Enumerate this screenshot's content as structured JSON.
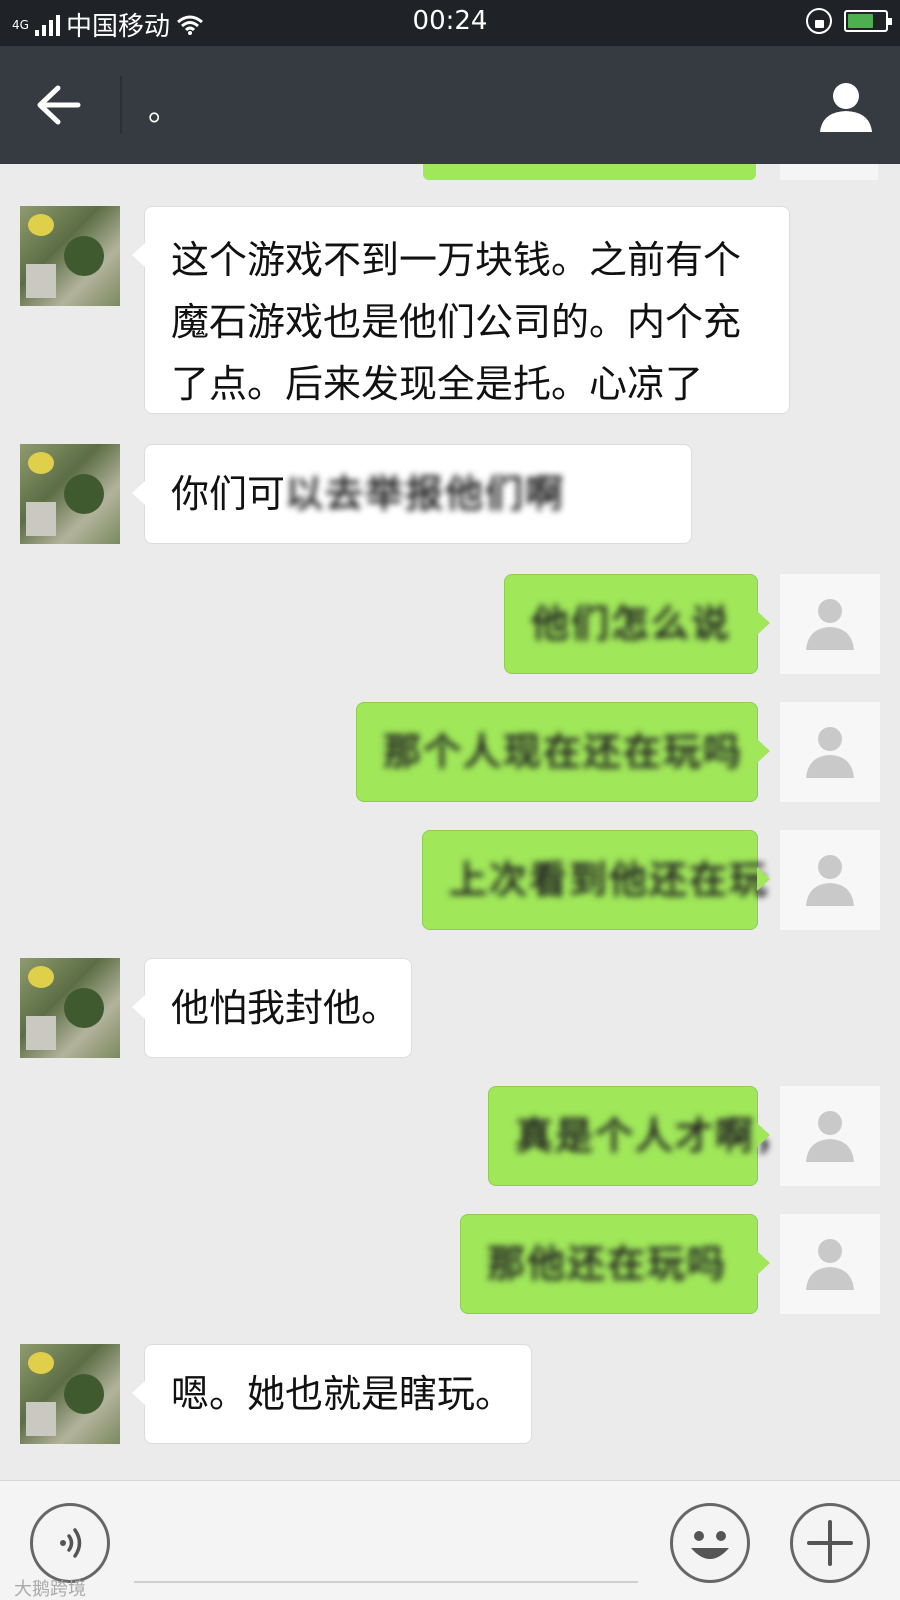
{
  "statusbar": {
    "network": "4G",
    "carrier": "中国移动",
    "time": "00:24"
  },
  "header": {
    "title": "。"
  },
  "messages": [
    {
      "text": "这个游戏不到一万块钱。之前有个魔石游戏也是他们公司的。内个充了点。后来发现全是托。心凉了",
      "line1": "这个游戏不到一万块钱。之前有个",
      "line2": "魔石游戏也是他们公司的。内个充",
      "line3": "了点。后来发现全是托。心凉了"
    },
    {
      "prefix": "你们可",
      "blurred": "以去举报他们啊"
    },
    {
      "blurred": "他们怎么说"
    },
    {
      "blurred": "那个人现在还在玩吗"
    },
    {
      "blurred": "上次看到他还在玩"
    },
    {
      "text": "他怕我封他。"
    },
    {
      "blurred": "真是个人才啊，"
    },
    {
      "blurred": "那他还在玩吗"
    },
    {
      "text": "嗯。她也就是瞎玩。"
    }
  ],
  "footer": {
    "watermark": "大鹅跨境"
  },
  "colors": {
    "titlebar": "#363b41",
    "outgoing_bubble": "#a0e75a",
    "incoming_bubble": "#ffffff",
    "background": "#ebebeb"
  }
}
